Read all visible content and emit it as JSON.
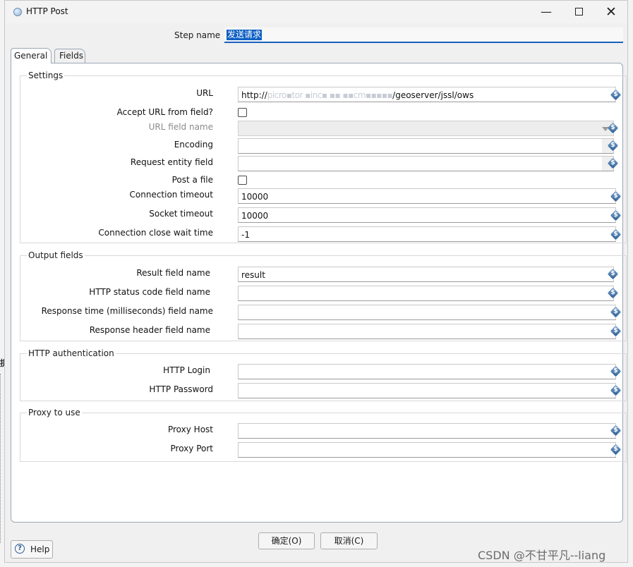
{
  "window": {
    "title": "HTTP Post",
    "minimize_glyph": "—",
    "close_glyph": "✕"
  },
  "step": {
    "label": "Step name",
    "value": "发送请求"
  },
  "tabs": [
    {
      "label": "General"
    },
    {
      "label": "Fields"
    }
  ],
  "groups": {
    "settings": {
      "title": "Settings",
      "url_label": "URL",
      "url_prefix": "http://",
      "url_obscured": "picro▪tor ▪inc▪ ▪▪ ▪▪cm▪▪▪▪▪",
      "url_suffix": "/geoserver/jssl/ows",
      "accept_url_label": "Accept URL from field?",
      "url_field_name_label": "URL field name",
      "url_field_name_value": "",
      "encoding_label": "Encoding",
      "encoding_value": "",
      "request_entity_label": "Request entity field",
      "request_entity_value": "",
      "post_file_label": "Post a file",
      "connection_timeout_label": "Connection timeout",
      "connection_timeout_value": "10000",
      "socket_timeout_label": "Socket timeout",
      "socket_timeout_value": "10000",
      "close_wait_label": "Connection close wait time",
      "close_wait_value": "-1"
    },
    "output": {
      "title": "Output fields",
      "result_label": "Result field name",
      "result_value": "result",
      "status_label": "HTTP status code field name",
      "status_value": "",
      "response_time_label": "Response time (milliseconds) field name",
      "response_time_value": "",
      "response_header_label": "Response header field name",
      "response_header_value": ""
    },
    "auth": {
      "title": "HTTP authentication",
      "login_label": "HTTP Login",
      "login_value": "",
      "password_label": "HTTP Password",
      "password_value": ""
    },
    "proxy": {
      "title": "Proxy to use",
      "host_label": "Proxy Host",
      "host_value": "",
      "port_label": "Proxy Port",
      "port_value": ""
    }
  },
  "variable_icon_glyph": "$",
  "buttons": {
    "ok": "确定(O)",
    "cancel": "取消(C)",
    "help": "Help",
    "help_glyph": "?"
  },
  "background_edge_char": "提",
  "watermark": "CSDN @不甘平凡--liang"
}
